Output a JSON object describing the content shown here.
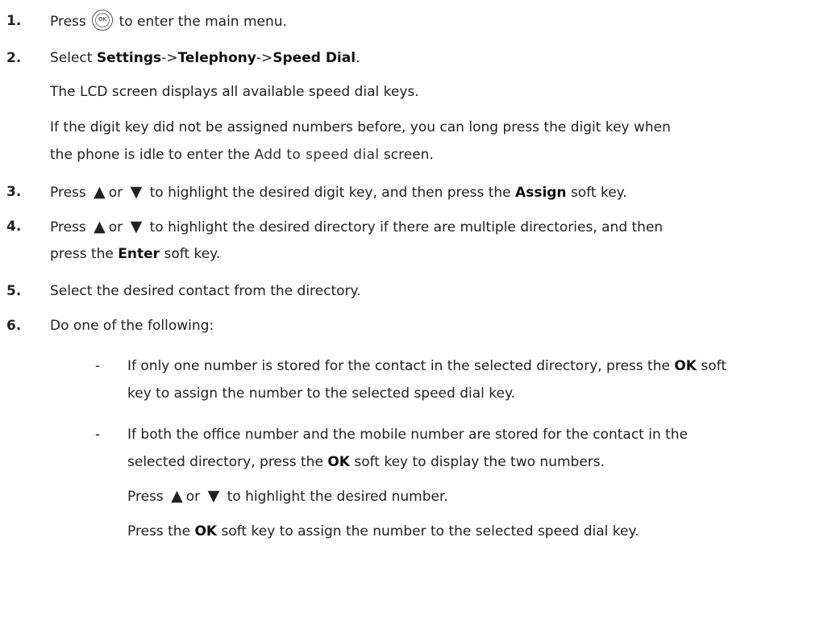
{
  "steps": [
    {
      "num": "1.",
      "pre": "Press",
      "icon_label": "OK",
      "post": "to enter the main menu."
    },
    {
      "num": "2.",
      "pre": "Select ",
      "b1": "Settings",
      "sep1": "->",
      "b2": "Telephony",
      "sep2": "->",
      "b3": "Speed Dial",
      "post": "."
    },
    {
      "num": "3.",
      "pre": "Press",
      "arrow_up": "▲",
      "or": "or",
      "arrow_down": "▼",
      "mid": "to highlight the desired digit key, and then press the ",
      "b1": "Assign",
      "post": " soft key."
    },
    {
      "num": "4.",
      "pre": "Press",
      "arrow_up": "▲",
      "or": "or",
      "arrow_down": "▼",
      "mid": "to highlight the desired directory if there are multiple directories, and then",
      "cont_pre": "press the ",
      "b1": "Enter",
      "post": " soft key."
    },
    {
      "num": "5.",
      "text": "Select the desired contact from the directory."
    },
    {
      "num": "6.",
      "text": "Do one of the following:"
    }
  ],
  "step2_notes": {
    "p1": "The LCD screen displays all available speed dial keys.",
    "p2_line1": "If the digit key did not be assigned numbers before, you can long press the digit key when",
    "p2_line2_pre": "the phone is idle to enter the ",
    "p2_screen": "Add to speed dial",
    "p2_line2_post": " screen."
  },
  "bullets": {
    "dash": "-",
    "b1_line1_pre": "If only one number is stored for the contact in the selected directory, press the ",
    "b1_ok": "OK",
    "b1_line1_post": " soft",
    "b1_line2": "key to assign the number to the selected speed dial key.",
    "b2_line1": "If both the office number and the mobile number are stored for the contact in the",
    "b2_line2_pre": "selected directory, press the ",
    "b2_ok": "OK",
    "b2_line2_post": " soft key to display the two numbers.",
    "b2_press": "Press",
    "b2_up": "▲",
    "b2_or": "or",
    "b2_down": "▼",
    "b2_highlight": "to highlight the desired number.",
    "b2_final_pre": "Press the ",
    "b2_final_ok": "OK",
    "b2_final_post": " soft key to assign the number to the selected speed dial key."
  }
}
